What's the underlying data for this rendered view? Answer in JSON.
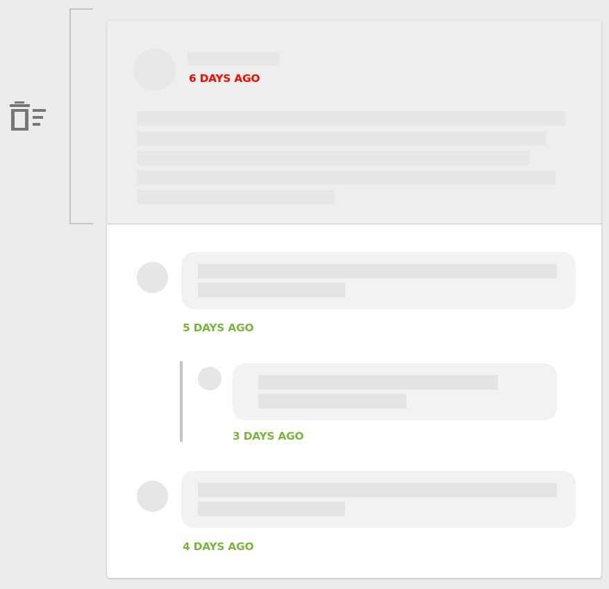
{
  "post": {
    "timestamp": "6 DAYS AGO"
  },
  "comments": [
    {
      "timestamp": "5 DAYS AGO"
    },
    {
      "timestamp": "3 DAYS AGO"
    },
    {
      "timestamp": "4 DAYS AGO"
    }
  ],
  "colors": {
    "deleted_timestamp": "#f00d00",
    "comment_timestamp": "#7cb342",
    "background": "#ececec",
    "card": "#ffffff",
    "placeholder": "#e5e5e5"
  },
  "icons": {
    "left": "trash-list-icon"
  }
}
